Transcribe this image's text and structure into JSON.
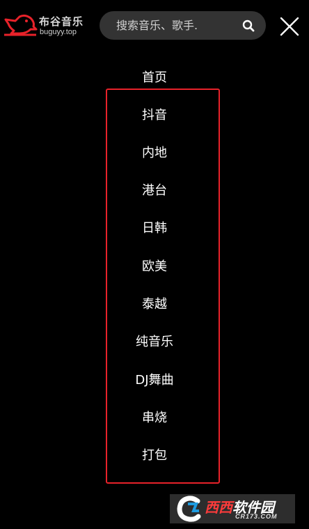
{
  "header": {
    "logo_title": "布谷音乐",
    "logo_subtitle": "buguyy.top",
    "search_placeholder": "搜索音乐、歌手.",
    "search_icon": "search-icon",
    "close_icon": "close-icon"
  },
  "menu": {
    "items": [
      {
        "label": "首页"
      },
      {
        "label": "抖音"
      },
      {
        "label": "内地"
      },
      {
        "label": "港台"
      },
      {
        "label": "日韩"
      },
      {
        "label": "欧美"
      },
      {
        "label": "泰越"
      },
      {
        "label": "纯音乐"
      },
      {
        "label": "DJ舞曲"
      },
      {
        "label": "串烧"
      },
      {
        "label": "打包"
      }
    ]
  },
  "watermark": {
    "brand_red": "西西",
    "brand_white": "软件园",
    "url": "CR173.COM"
  },
  "colors": {
    "background": "#000000",
    "accent": "#e8222a",
    "search_bg": "#333333"
  }
}
